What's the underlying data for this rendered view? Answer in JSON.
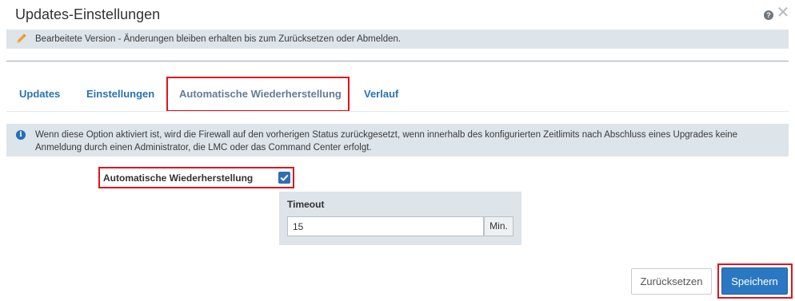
{
  "dialog": {
    "title": "Updates-Einstellungen",
    "help_icon_glyph": "?",
    "help_icon": "question-circle-icon",
    "close_icon": "close-icon"
  },
  "edit_banner": {
    "icon": "pencil-icon",
    "text": "Bearbeitete Version - Änderungen bleiben erhalten bis zum Zurücksetzen oder Abmelden."
  },
  "tabs": [
    {
      "label": "Updates",
      "active": false
    },
    {
      "label": "Einstellungen",
      "active": false
    },
    {
      "label": "Automatische Wiederherstellung",
      "active": true
    },
    {
      "label": "Verlauf",
      "active": false
    }
  ],
  "info_banner": {
    "icon": "info-icon",
    "icon_glyph": "i",
    "text": "Wenn diese Option aktiviert ist, wird die Firewall auf den vorherigen Status zurückgesetzt, wenn innerhalb des konfigurierten Zeitlimits nach Abschluss eines Upgrades keine Anmeldung durch einen Administrator, die LMC oder das Command Center erfolgt."
  },
  "auto_restore": {
    "label": "Automatische Wiederherstellung",
    "checked": true
  },
  "timeout": {
    "label": "Timeout",
    "value": "15",
    "unit": "Min."
  },
  "buttons": {
    "reset": "Zurücksetzen",
    "save": "Speichern"
  },
  "colors": {
    "accent": "#2b78c2",
    "highlight": "#e0141c",
    "banner": "#dde4ea"
  }
}
